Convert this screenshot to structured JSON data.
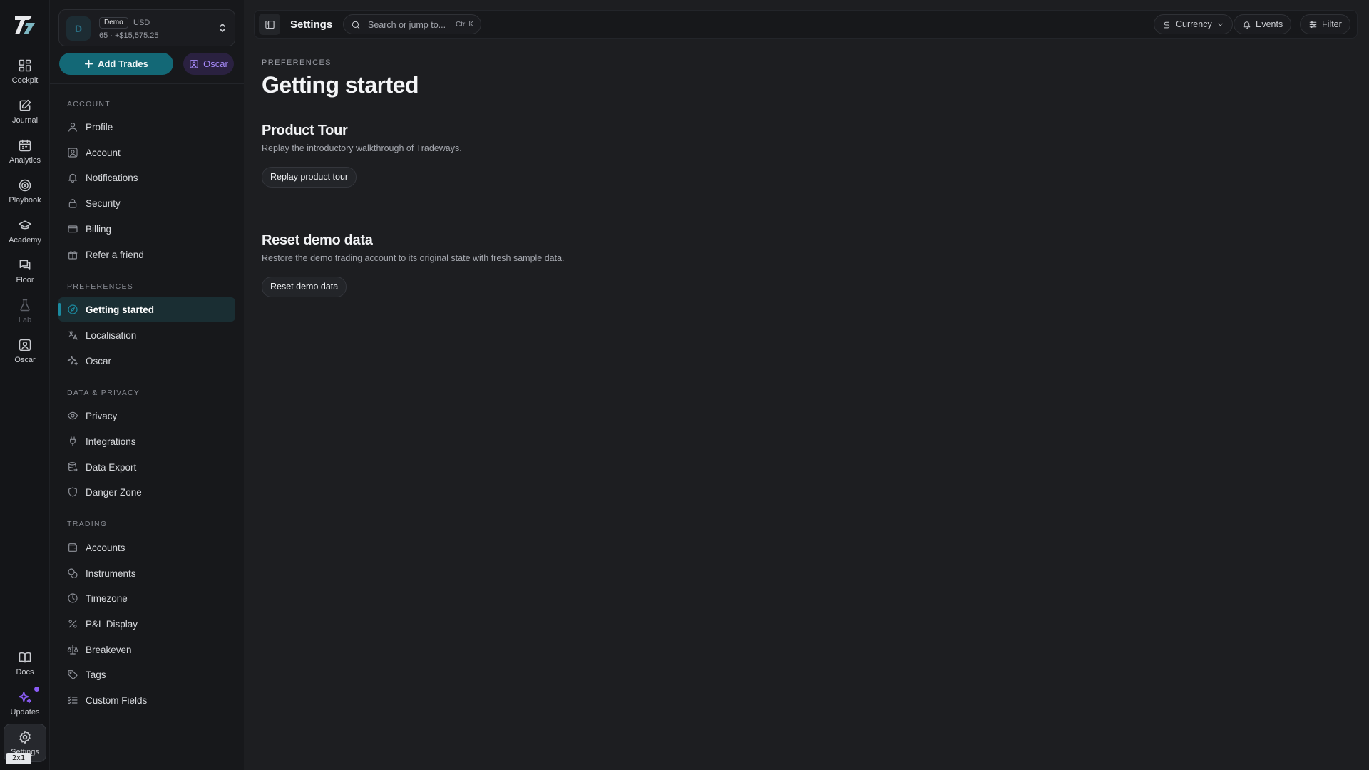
{
  "rail": {
    "items": [
      {
        "label": "Cockpit",
        "icon": "grid-icon"
      },
      {
        "label": "Journal",
        "icon": "journal-icon"
      },
      {
        "label": "Analytics",
        "icon": "calendar-icon"
      },
      {
        "label": "Playbook",
        "icon": "target-icon"
      },
      {
        "label": "Academy",
        "icon": "graduation-cap-icon"
      },
      {
        "label": "Floor",
        "icon": "chat-icon"
      },
      {
        "label": "Lab",
        "icon": "flask-icon"
      },
      {
        "label": "Oscar",
        "icon": "user-square-icon"
      }
    ],
    "bottom": [
      {
        "label": "Docs",
        "icon": "book-icon"
      },
      {
        "label": "Updates",
        "icon": "sparkle-icon"
      },
      {
        "label": "Settings",
        "icon": "gear-icon"
      }
    ],
    "ratio_badge": "2x1"
  },
  "account_switcher": {
    "avatar": "D",
    "badge": "Demo",
    "currency": "USD",
    "summary": "65 · +$15,575.25"
  },
  "actions": {
    "add_trades": "Add Trades",
    "oscar": "Oscar"
  },
  "sidebar": {
    "sections": [
      {
        "title": "ACCOUNT",
        "items": [
          "Profile",
          "Account",
          "Notifications",
          "Security",
          "Billing",
          "Refer a friend"
        ]
      },
      {
        "title": "PREFERENCES",
        "items": [
          "Getting started",
          "Localisation",
          "Oscar"
        ]
      },
      {
        "title": "DATA & PRIVACY",
        "items": [
          "Privacy",
          "Integrations",
          "Data Export",
          "Danger Zone"
        ]
      },
      {
        "title": "TRADING",
        "items": [
          "Accounts",
          "Instruments",
          "Timezone",
          "P&L Display",
          "Breakeven",
          "Tags",
          "Custom Fields"
        ]
      }
    ],
    "active_item": "Getting started"
  },
  "topbar": {
    "title": "Settings",
    "search_placeholder": "Search or jump to...",
    "search_shortcut": "Ctrl K",
    "currency": "Currency",
    "events": "Events",
    "filter": "Filter"
  },
  "page": {
    "breadcrumb": "PREFERENCES",
    "title": "Getting started",
    "sections": [
      {
        "heading": "Product Tour",
        "description": "Replay the introductory walkthrough of Tradeways.",
        "button": "Replay product tour"
      },
      {
        "heading": "Reset demo data",
        "description": "Restore the demo trading account to its original state with fresh sample data.",
        "button": "Reset demo data"
      }
    ]
  },
  "colors": {
    "accent": "#136876",
    "oscar_purple": "#a78bfa",
    "background": "#1d1e21"
  }
}
